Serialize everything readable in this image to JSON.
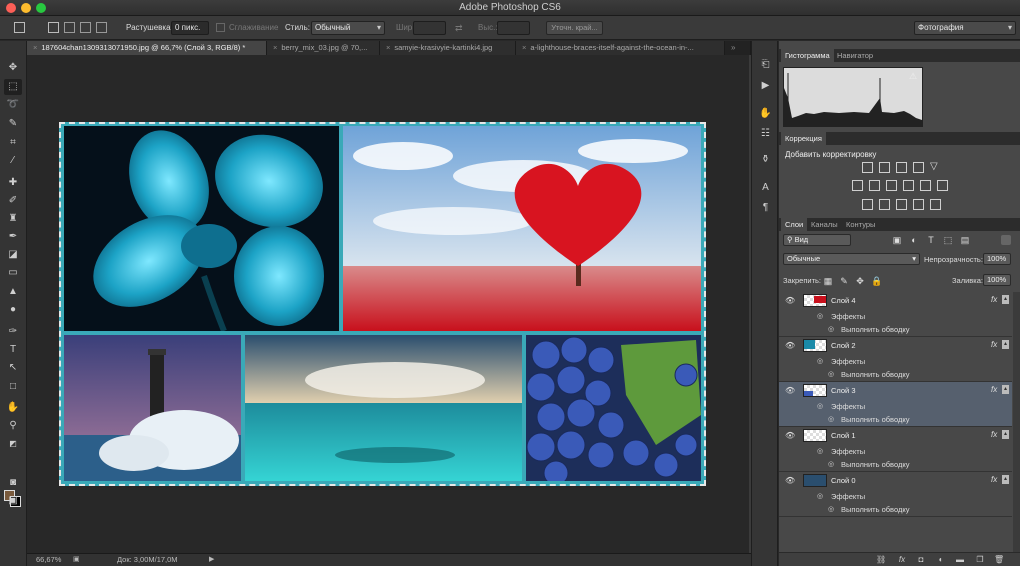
{
  "app": {
    "title": "Adobe Photoshop CS6"
  },
  "options": {
    "feather_label": "Растушевка:",
    "feather_value": "0 пикс.",
    "antialias_label": "Сглаживание",
    "style_label": "Стиль:",
    "style_value": "Обычный",
    "width_label": "Шир.:",
    "height_label": "Выс.:",
    "refine_edge_label": "Уточн. край...",
    "workspace_value": "Фотография"
  },
  "tabs": [
    {
      "label": "187604chan1309313071950.jpg @ 66,7% (Слой 3, RGB/8) *"
    },
    {
      "label": "berry_mix_03.jpg @ 70,..."
    },
    {
      "label": "samyie-krasivyie-kartinki4.jpg"
    },
    {
      "label": "a-lighthouse-braces-itself-against-the-ocean-in-..."
    }
  ],
  "status": {
    "zoom": "66,67%",
    "doc": "Док: 3,00M/17,0M"
  },
  "panels": {
    "top_tabs": [
      "Гистограмма",
      "Навигатор"
    ],
    "correction_tab": "Коррекция",
    "correction_title": "Добавить корректировку",
    "layers_tabs": [
      "Слои",
      "Каналы",
      "Контуры"
    ],
    "filter_value": "Вид",
    "blend_mode": "Обычные",
    "opacity_label": "Непрозрачность:",
    "opacity_value": "100%",
    "lock_label": "Закрепить:",
    "fill_label": "Заливка:",
    "fill_value": "100%"
  },
  "layers": [
    {
      "name": "Слой 4",
      "effects": "Эффекты",
      "stroke": "Выполнить обводку",
      "fx": "fx",
      "selected": false
    },
    {
      "name": "Слой 2",
      "effects": "Эффекты",
      "stroke": "Выполнить обводку",
      "fx": "fx",
      "selected": false
    },
    {
      "name": "Слой 3",
      "effects": "Эффекты",
      "stroke": "Выполнить обводку",
      "fx": "fx",
      "selected": true
    },
    {
      "name": "Слой 1",
      "effects": "Эффекты",
      "stroke": "Выполнить обводку",
      "fx": "fx",
      "selected": false
    },
    {
      "name": "Слой 0",
      "effects": "Эффекты",
      "stroke": "Выполнить обводку",
      "fx": "fx",
      "selected": false
    }
  ],
  "colors": {
    "frame": "#3aa9b8",
    "selected_layer": "#56606e",
    "foreground": "#7a5a3c",
    "background": "#000000"
  }
}
